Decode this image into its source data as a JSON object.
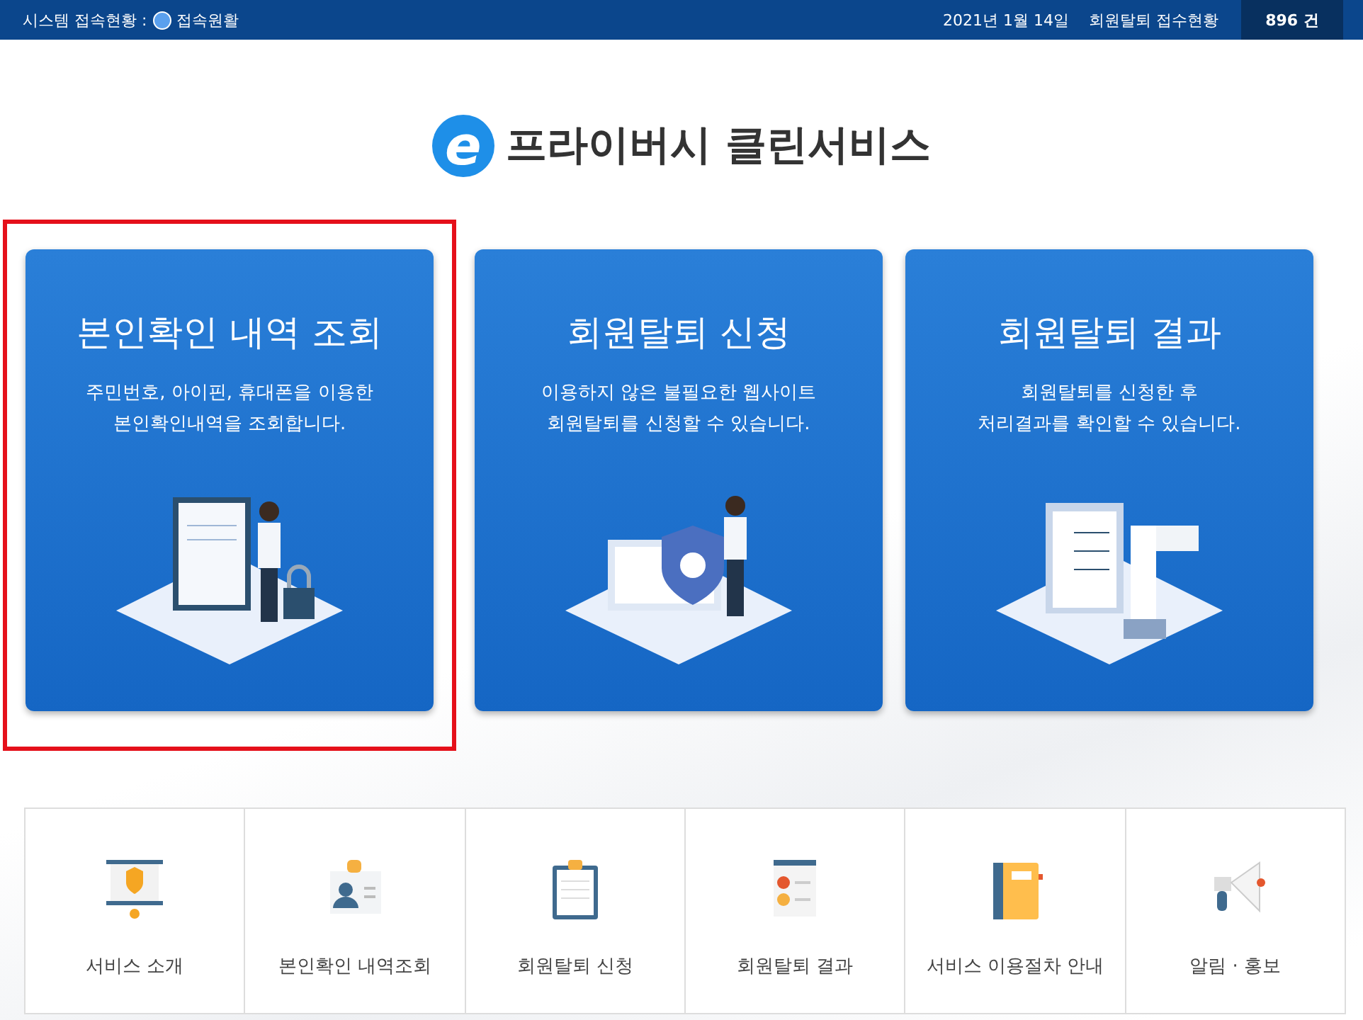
{
  "top_bar": {
    "status_label": "시스템 접속현황 :",
    "status_value": "접속원활",
    "date": "2021년 1월 14일",
    "count_label": "회원탈퇴 접수현황",
    "count": "896 건"
  },
  "logo": {
    "mark": "e",
    "title": "프라이버시 클린서비스"
  },
  "cards": [
    {
      "kind": "identity",
      "title": "본인확인 내역 조회",
      "lines": [
        "주민번호, 아이핀, 휴대폰을 이용한",
        "본인확인내역을 조회합니다."
      ],
      "highlighted": true
    },
    {
      "kind": "withdraw",
      "title": "회원탈퇴 신청",
      "lines": [
        "이용하지 않은 불필요한 웹사이트",
        "회원탈퇴를 신청할 수 있습니다."
      ],
      "highlighted": false
    },
    {
      "kind": "result",
      "title": "회원탈퇴 결과",
      "lines": [
        "회원탈퇴를 신청한 후",
        "처리결과를 확인할 수 있습니다."
      ],
      "highlighted": false
    }
  ],
  "menu": [
    {
      "kind": "intro",
      "label": "서비스 소개"
    },
    {
      "kind": "idcard",
      "label": "본인확인 내역조회"
    },
    {
      "kind": "clipboard",
      "label": "회원탈퇴 신청"
    },
    {
      "kind": "checklist",
      "label": "회원탈퇴 결과"
    },
    {
      "kind": "notebook",
      "label": "서비스 이용절차 안내"
    },
    {
      "kind": "megaphone",
      "label": "알림 · 홍보"
    }
  ]
}
